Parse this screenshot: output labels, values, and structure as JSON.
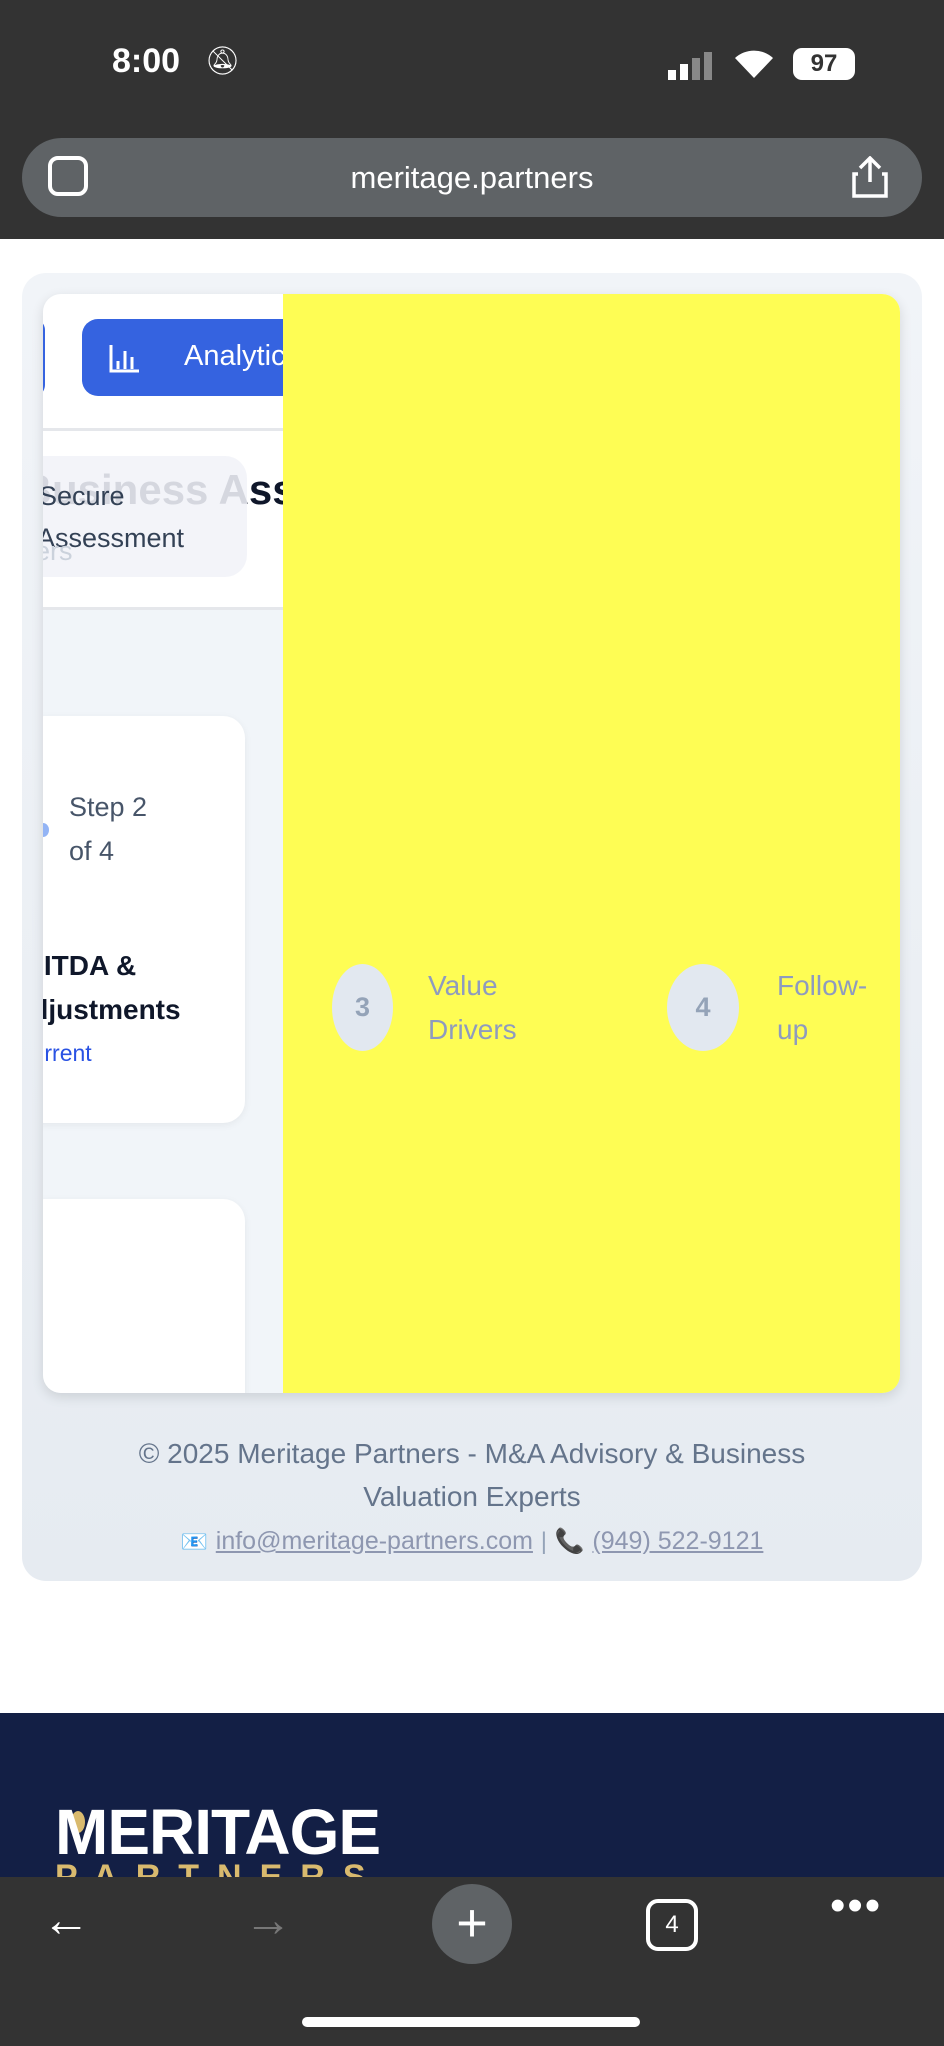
{
  "status": {
    "time": "8:00",
    "battery": "97"
  },
  "browser": {
    "url": "meritage.partners",
    "tab_count": "4"
  },
  "nav": {
    "analytics": "Analytics"
  },
  "heading": "Business Assessment",
  "chip": {
    "line1": "Secure",
    "line2": "Assessment",
    "faint": "ers"
  },
  "step_card": {
    "step_line1": "Step 2",
    "step_line2": "of 4",
    "title_line1": "EBITDA &",
    "title_line2": "Adjustments",
    "status": "Current"
  },
  "steps": [
    {
      "number": "3",
      "line1": "Value",
      "line2": "Drivers"
    },
    {
      "number": "4",
      "line1": "Follow-",
      "line2": "up"
    }
  ],
  "footer": {
    "copyright": "© 2025 Meritage Partners - M&A Advisory & Business Valuation Experts",
    "email": "info@meritage-partners.com",
    "separator": "|",
    "phone": "(949) 522-9121"
  },
  "brand": {
    "logo_top": "MERITAGE",
    "logo_bottom": "PARTNERS"
  },
  "colors": {
    "accent": "#3563e0",
    "highlight": "#fefd54",
    "navy": "#131f45"
  }
}
